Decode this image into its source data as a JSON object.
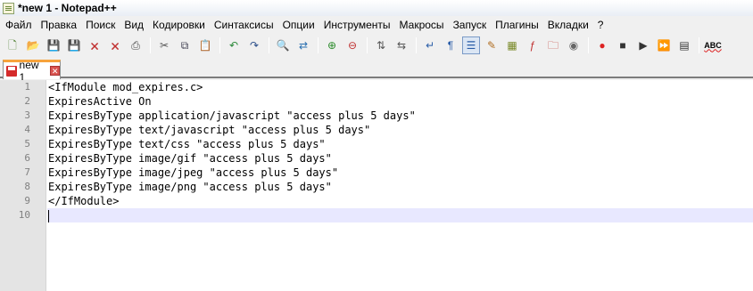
{
  "window": {
    "title": "*new 1 - Notepad++"
  },
  "menu": [
    "Файл",
    "Правка",
    "Поиск",
    "Вид",
    "Кодировки",
    "Синтаксисы",
    "Опции",
    "Инструменты",
    "Макросы",
    "Запуск",
    "Плагины",
    "Вкладки",
    "?"
  ],
  "toolbar": {
    "groups": [
      [
        "new-file-icon",
        "open-file-icon",
        "save-icon",
        "save-all-icon",
        "close-icon",
        "close-all-icon",
        "print-icon"
      ],
      [
        "cut-icon",
        "copy-icon",
        "paste-icon"
      ],
      [
        "undo-icon",
        "redo-icon"
      ],
      [
        "find-icon",
        "replace-icon"
      ],
      [
        "zoom-in-icon",
        "zoom-out-icon"
      ],
      [
        "sync-vertical-icon",
        "sync-horizontal-icon"
      ],
      [
        "word-wrap-icon",
        "show-all-chars-icon",
        "indent-guide-icon",
        "user-defined-language-icon",
        "doc-map-icon",
        "function-list-icon",
        "folder-workspace-icon",
        "monitoring-icon"
      ],
      [
        "record-macro-icon",
        "stop-record-icon",
        "play-macro-icon",
        "run-macro-multiple-icon",
        "save-macro-icon"
      ],
      [
        "spellcheck-icon"
      ]
    ],
    "spellcheck_label": "ABC"
  },
  "tabs": [
    {
      "label": "new 1",
      "close": "✕"
    }
  ],
  "editor": {
    "line_numbers": [
      "1",
      "2",
      "3",
      "4",
      "5",
      "6",
      "7",
      "8",
      "9",
      "10"
    ],
    "lines": [
      "<IfModule mod_expires.c>",
      "ExpiresActive On",
      "ExpiresByType application/javascript \"access plus 5 days\"",
      "ExpiresByType text/javascript \"access plus 5 days\"",
      "ExpiresByType text/css \"access plus 5 days\"",
      "ExpiresByType image/gif \"access plus 5 days\"",
      "ExpiresByType image/jpeg \"access plus 5 days\"",
      "ExpiresByType image/png \"access plus 5 days\"",
      "</IfModule>",
      ""
    ],
    "current_line": 10
  },
  "colors": {
    "current_line": "#e8e8ff",
    "gutter": "#e4e4e4",
    "tab_accent": "#f7a33c"
  }
}
